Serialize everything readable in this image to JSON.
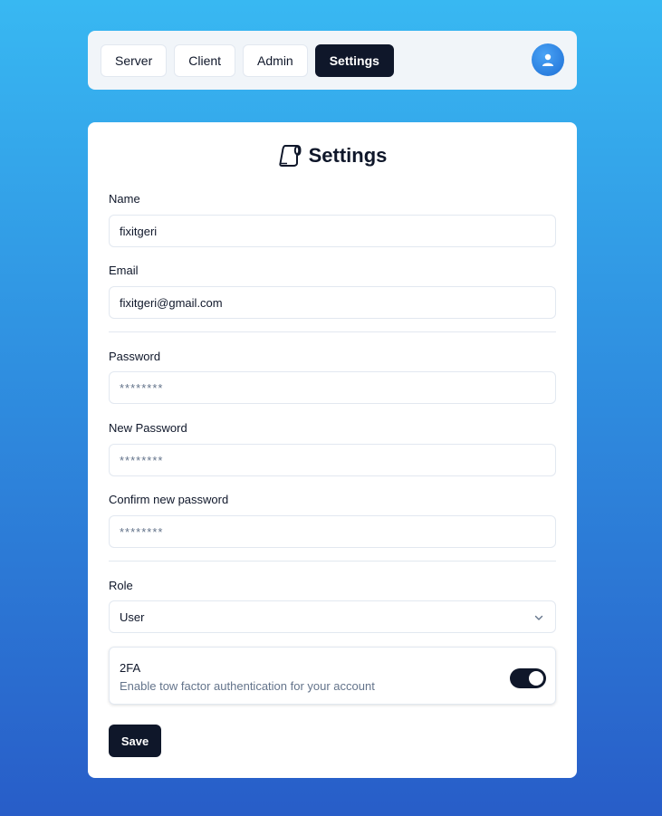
{
  "nav": {
    "tabs": [
      {
        "label": "Server"
      },
      {
        "label": "Client"
      },
      {
        "label": "Admin"
      },
      {
        "label": "Settings",
        "active": true
      }
    ]
  },
  "header": {
    "avatar_icon": "user-icon"
  },
  "settings": {
    "title": "Settings",
    "title_icon": "toilet-paper-icon",
    "name": {
      "label": "Name",
      "value": "fixitgeri"
    },
    "email": {
      "label": "Email",
      "value": "fixitgeri@gmail.com"
    },
    "password": {
      "label": "Password",
      "placeholder": "********"
    },
    "new_password": {
      "label": "New Password",
      "placeholder": "********"
    },
    "confirm_password": {
      "label": "Confirm new password",
      "placeholder": "********"
    },
    "role": {
      "label": "Role",
      "value": "User"
    },
    "twofa": {
      "title": "2FA",
      "description": "Enable tow factor authentication for your account",
      "enabled": true
    },
    "save_label": "Save"
  },
  "colors": {
    "accent": "#0f172a",
    "gradient_top": "#38b8f2",
    "gradient_bottom": "#285dc8"
  }
}
